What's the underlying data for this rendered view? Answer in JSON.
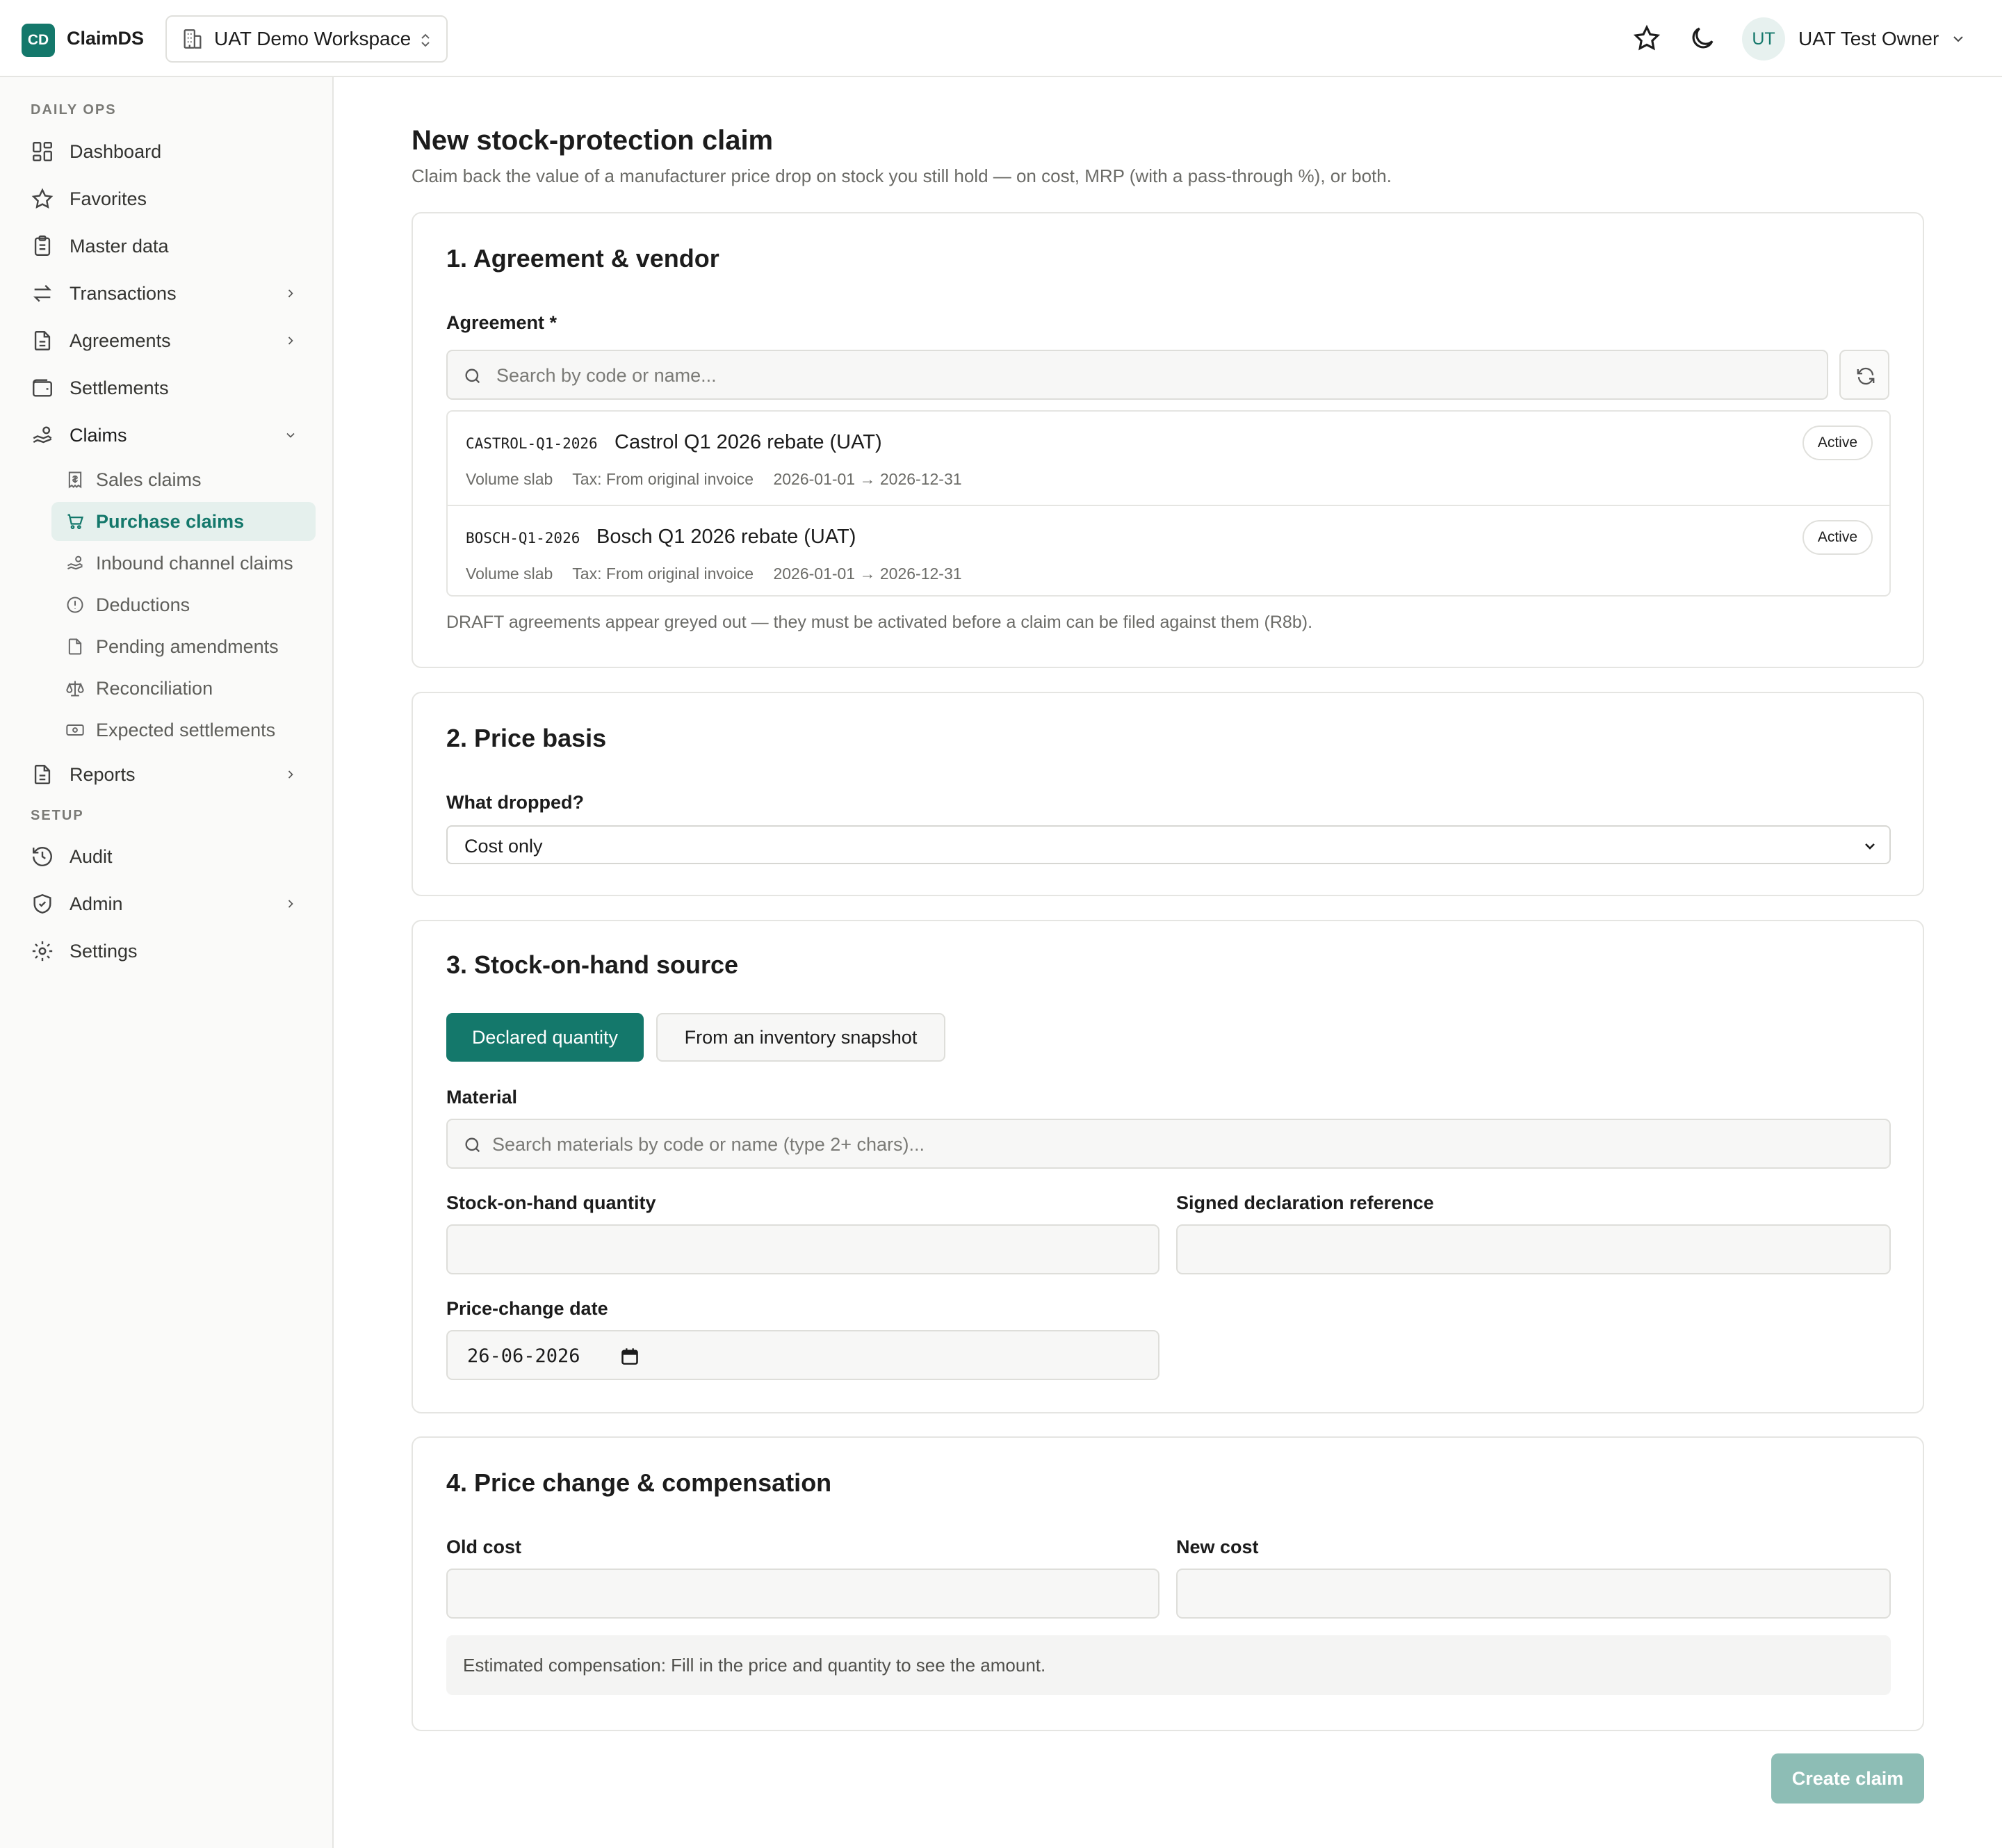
{
  "app": {
    "logo": "CD",
    "name": "ClaimDS"
  },
  "workspace": {
    "label": "UAT Demo Workspace",
    "icon": "building-icon"
  },
  "topbar": {
    "favorites_icon": "star-icon",
    "theme_icon": "moon-icon",
    "user_initials": "UT",
    "user_name": "UAT Test Owner"
  },
  "sidebar": {
    "section_daily": "DAILY OPS",
    "section_setup": "SETUP",
    "items": [
      {
        "label": "Dashboard",
        "icon": "dashboard-icon"
      },
      {
        "label": "Favorites",
        "icon": "star-icon"
      },
      {
        "label": "Master data",
        "icon": "clipboard-icon"
      },
      {
        "label": "Transactions",
        "icon": "arrows-icon"
      },
      {
        "label": "Agreements",
        "icon": "document-icon"
      },
      {
        "label": "Settlements",
        "icon": "wallet-icon"
      },
      {
        "label": "Claims",
        "icon": "hand-coins-icon"
      },
      {
        "label": "Reports",
        "icon": "report-icon"
      },
      {
        "label": "Audit",
        "icon": "history-icon"
      },
      {
        "label": "Admin",
        "icon": "shield-icon"
      },
      {
        "label": "Settings",
        "icon": "gear-icon"
      }
    ],
    "claims_sub": [
      {
        "label": "Sales claims",
        "icon": "receipt-icon"
      },
      {
        "label": "Purchase claims",
        "icon": "cart-icon"
      },
      {
        "label": "Inbound channel claims",
        "icon": "hand-coins-icon"
      },
      {
        "label": "Deductions",
        "icon": "alert-circle-icon"
      },
      {
        "label": "Pending amendments",
        "icon": "file-icon"
      },
      {
        "label": "Reconciliation",
        "icon": "scale-icon"
      },
      {
        "label": "Expected settlements",
        "icon": "banknote-icon"
      }
    ]
  },
  "page": {
    "title": "New stock-protection claim",
    "subtitle": "Claim back the value of a manufacturer price drop on stock you still hold — on cost, MRP (with a pass-through %), or both."
  },
  "section1": {
    "title": "1. Agreement & vendor",
    "agreement_label": "Agreement *",
    "search_placeholder": "Search by code or name...",
    "agreements": [
      {
        "code": "CASTROL-Q1-2026",
        "name": "Castrol Q1 2026 rebate (UAT)",
        "type": "Volume slab",
        "tax": "Tax: From original invoice",
        "period": "2026-01-01 → 2026-12-31",
        "status": "Active"
      },
      {
        "code": "BOSCH-Q1-2026",
        "name": "Bosch Q1 2026 rebate (UAT)",
        "type": "Volume slab",
        "tax": "Tax: From original invoice",
        "period": "2026-01-01 → 2026-12-31",
        "status": "Active"
      }
    ],
    "hint": "DRAFT agreements appear greyed out — they must be activated before a claim can be filed against them (R8b)."
  },
  "section2": {
    "title": "2. Price basis",
    "label": "What dropped?",
    "value": "Cost only"
  },
  "section3": {
    "title": "3. Stock-on-hand source",
    "opt_declared": "Declared quantity",
    "opt_snapshot": "From an inventory snapshot",
    "material_label": "Material",
    "material_placeholder": "Search materials by code or name (type 2+ chars)...",
    "qty_label": "Stock-on-hand quantity",
    "decl_label": "Signed declaration reference",
    "date_label": "Price-change date",
    "date_value": "26-06-2026"
  },
  "section4": {
    "title": "4. Price change & compensation",
    "old_label": "Old cost",
    "new_label": "New cost",
    "estimate": "Estimated compensation: Fill in the price and quantity to see the amount."
  },
  "actions": {
    "create": "Create claim"
  },
  "colors": {
    "accent": "#14786b",
    "accent_light": "#e5f0ed",
    "disabled_button": "#8dbdb5"
  }
}
